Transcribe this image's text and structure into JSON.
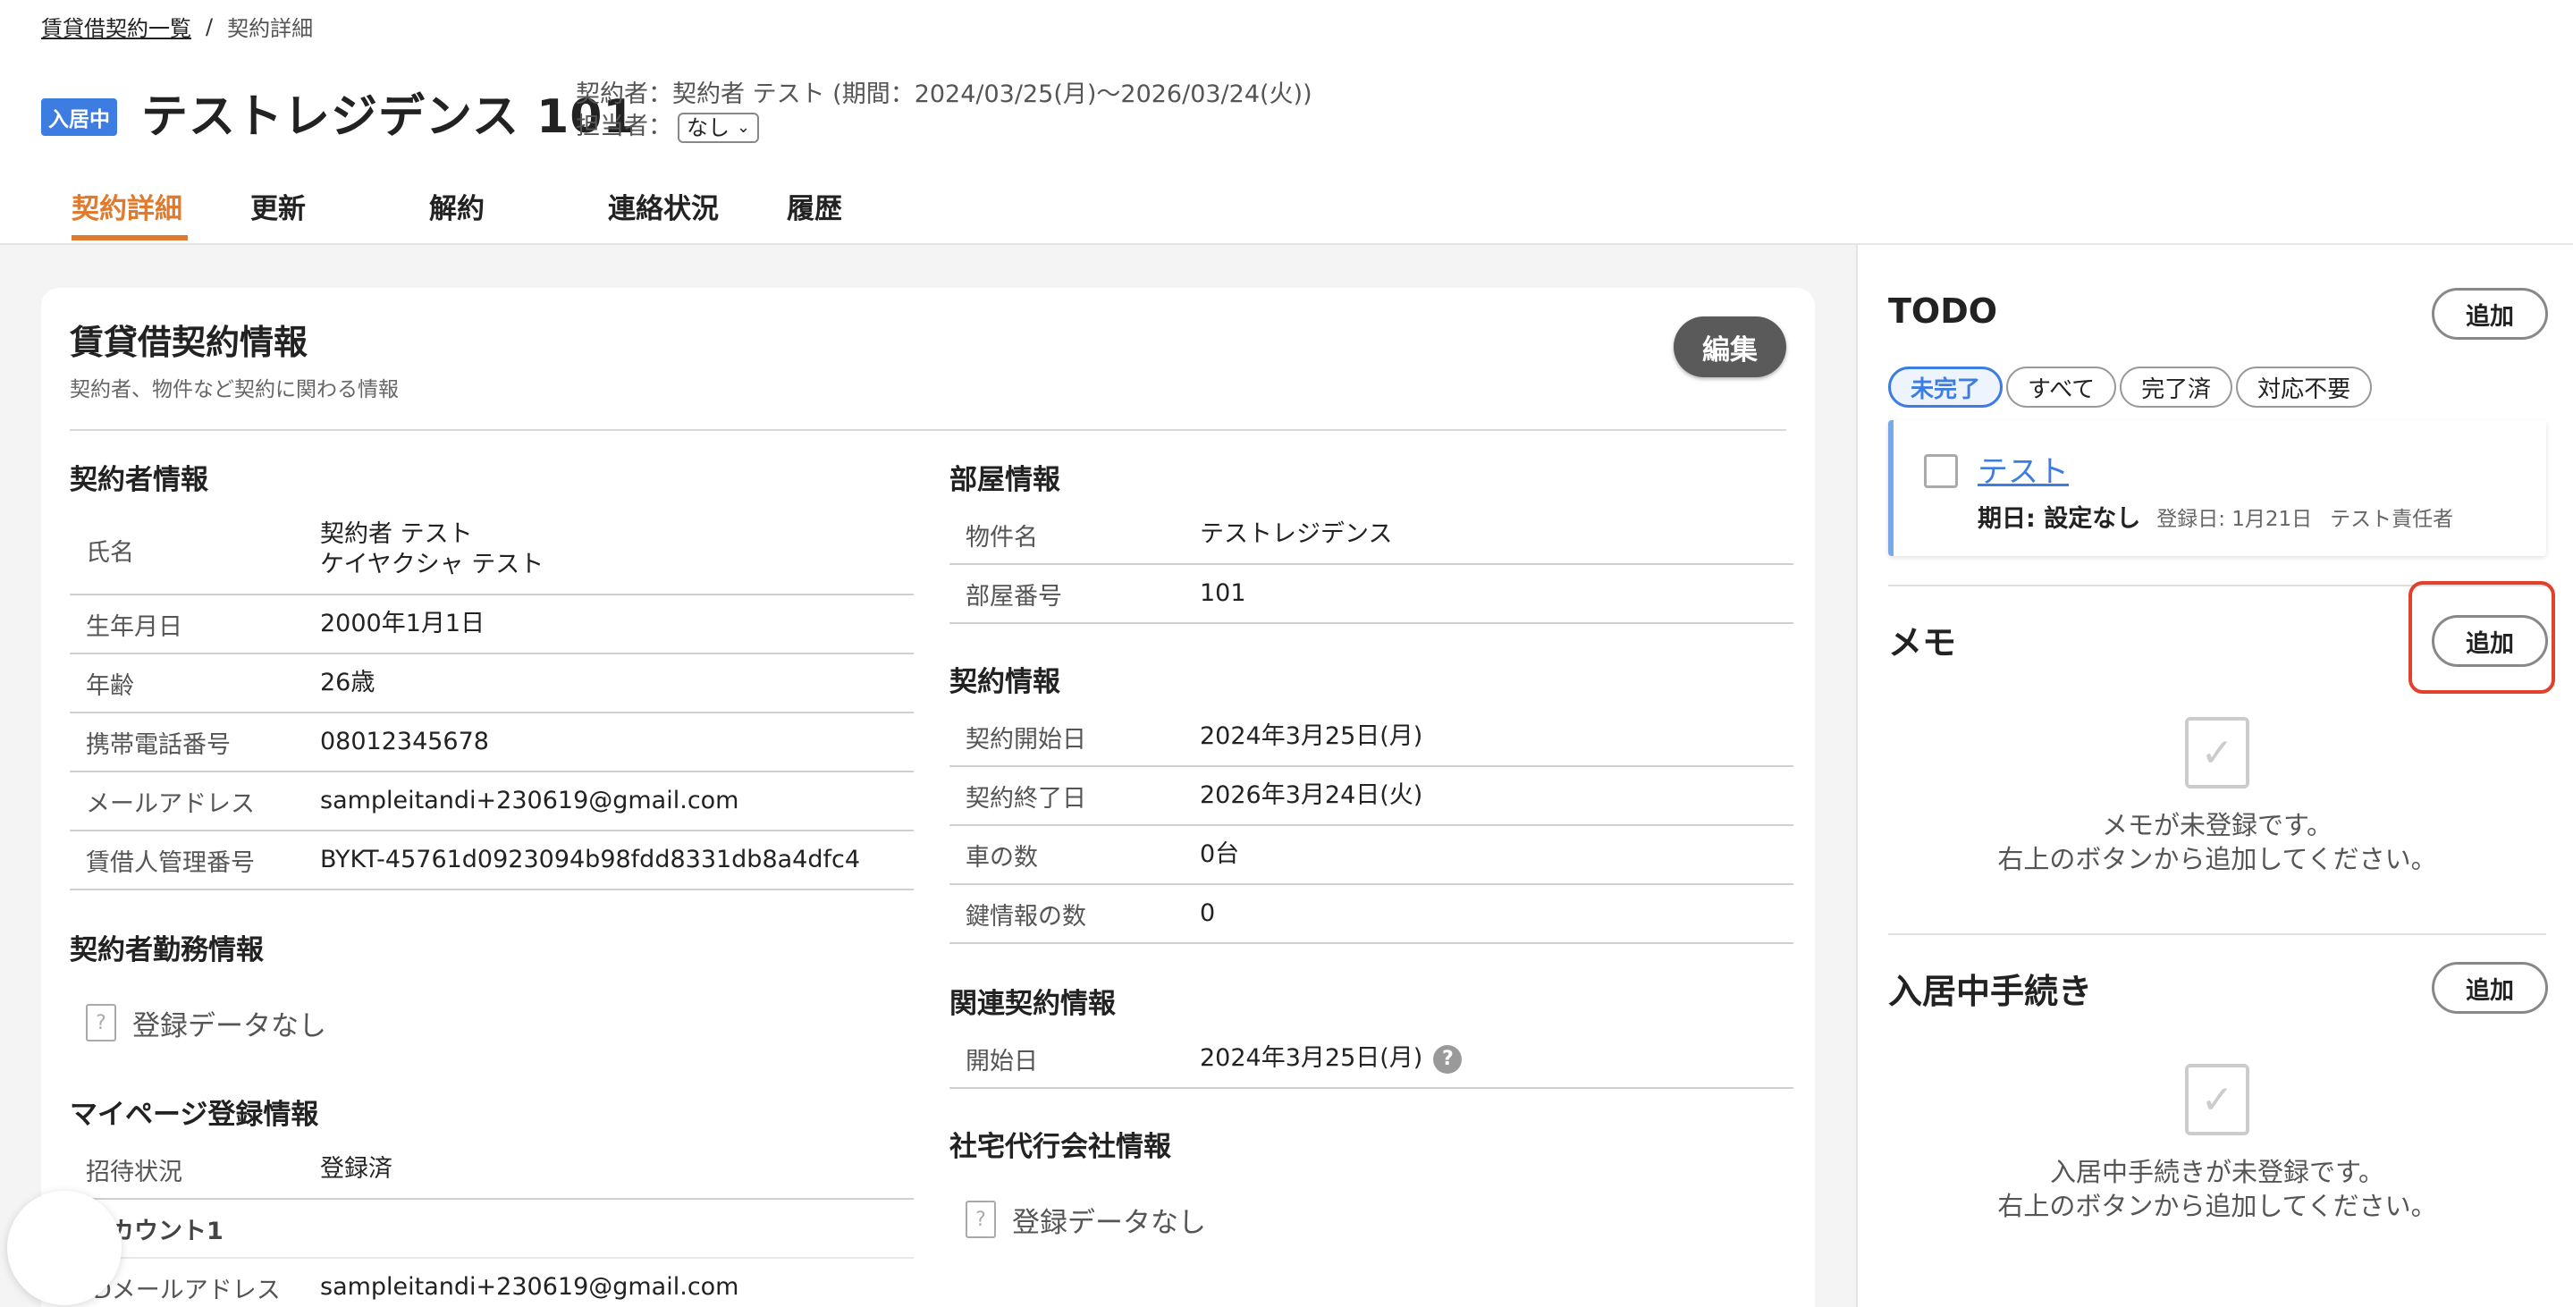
{
  "breadcrumb": {
    "parent": "賃貸借契約一覧",
    "separator": "/",
    "current": "契約詳細"
  },
  "header": {
    "status_badge": "入居中",
    "title": "テストレジデンス 101",
    "contractor_line": "契約者：契約者 テスト (期間：2024/03/25(月)〜2026/03/24(火))",
    "assignee_label": "担当者：",
    "assignee_value": "なし"
  },
  "tabs": [
    "契約詳細",
    "更新",
    "解約",
    "連絡状況",
    "履歴"
  ],
  "card": {
    "title": "賃貸借契約情報",
    "subtitle": "契約者、物件など契約に関わる情報",
    "edit_label": "編集"
  },
  "contractor": {
    "heading": "契約者情報",
    "name_label": "氏名",
    "name_value": "契約者 テスト",
    "name_kana": "ケイヤクシャ テスト",
    "rows": [
      {
        "k": "生年月日",
        "v": "2000年1月1日"
      },
      {
        "k": "年齢",
        "v": "26歳"
      },
      {
        "k": "携帯電話番号",
        "v": "08012345678"
      },
      {
        "k": "メールアドレス",
        "v": "sampleitandi+230619@gmail.com"
      },
      {
        "k": "賃借人管理番号",
        "v": "BYKT-45761d0923094b98fdd8331db8a4dfc4"
      }
    ]
  },
  "work": {
    "heading": "契約者勤務情報",
    "empty": "登録データなし"
  },
  "mypage": {
    "heading": "マイページ登録情報",
    "invite_label": "招待状況",
    "invite_value": "登録済",
    "account_label": "アカウント1",
    "email_label": "IDメールアドレス",
    "email_value": "sampleitandi+230619@gmail.com"
  },
  "room": {
    "heading": "部屋情報",
    "rows": [
      {
        "k": "物件名",
        "v": "テストレジデンス"
      },
      {
        "k": "部屋番号",
        "v": "101"
      }
    ]
  },
  "contract": {
    "heading": "契約情報",
    "rows": [
      {
        "k": "契約開始日",
        "v": "2024年3月25日(月)"
      },
      {
        "k": "契約終了日",
        "v": "2026年3月24日(火)"
      },
      {
        "k": "車の数",
        "v": "0台"
      },
      {
        "k": "鍵情報の数",
        "v": "0"
      }
    ]
  },
  "related": {
    "heading": "関連契約情報",
    "start_label": "開始日",
    "start_value": "2024年3月25日(月)"
  },
  "company": {
    "heading": "社宅代行会社情報",
    "empty": "登録データなし"
  },
  "todo": {
    "heading": "TODO",
    "add_label": "追加",
    "filters": [
      "未完了",
      "すべて",
      "完了済",
      "対応不要"
    ],
    "item_title": "テスト",
    "item_due": "期日: 設定なし",
    "item_registered": "登録日: 1月21日",
    "item_owner": "テスト責任者"
  },
  "memo": {
    "heading": "メモ",
    "add_label": "追加",
    "empty_line1": "メモが未登録です。",
    "empty_line2": "右上のボタンから追加してください。"
  },
  "procedures": {
    "heading": "入居中手続き",
    "add_label": "追加",
    "empty_line1": "入居中手続きが未登録です。",
    "empty_line2": "右上のボタンから追加してください。"
  },
  "colors": {
    "accent": "#e07a2f",
    "link": "#3d7ce0",
    "highlight": "#e2412c"
  }
}
